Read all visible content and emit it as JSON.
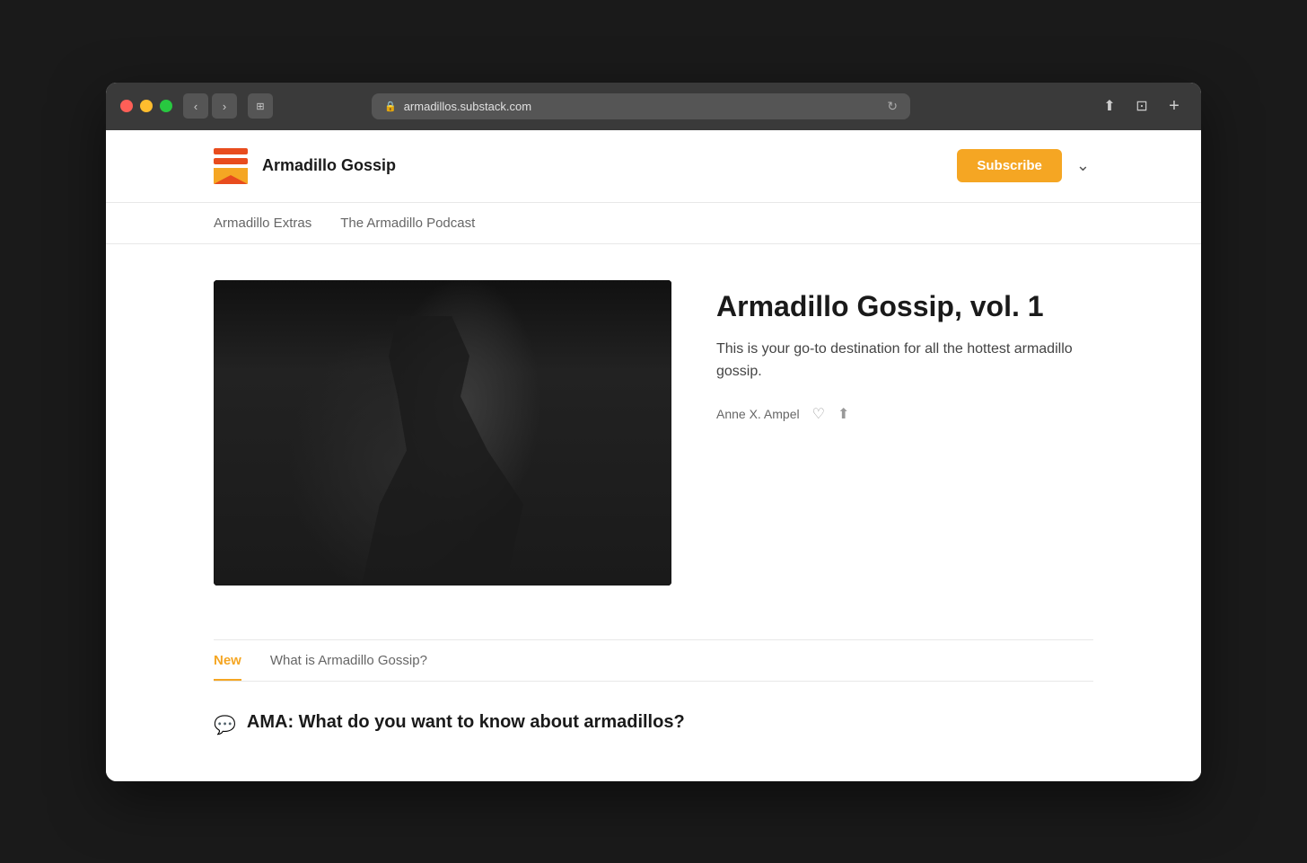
{
  "browser": {
    "url": "armadillos.substack.com",
    "back_label": "‹",
    "forward_label": "›",
    "sidebar_label": "⊞",
    "refresh_label": "↻",
    "share_label": "⬆",
    "tab_label": "⊡",
    "add_tab_label": "+"
  },
  "header": {
    "brand_name": "Armadillo Gossip",
    "subscribe_label": "Subscribe",
    "chevron_label": "⌄"
  },
  "nav": {
    "items": [
      {
        "label": "Armadillo Extras",
        "active": false
      },
      {
        "label": "The Armadillo Podcast",
        "active": false
      }
    ]
  },
  "featured": {
    "title": "Armadillo Gossip, vol. 1",
    "description": "This is your go-to destination for all the hottest armadillo gossip.",
    "author": "Anne X. Ampel"
  },
  "tabs": {
    "items": [
      {
        "label": "New",
        "active": true
      },
      {
        "label": "What is Armadillo Gossip?",
        "active": false
      }
    ]
  },
  "posts": [
    {
      "icon": "💬",
      "title": "AMA: What do you want to know about armadillos?"
    }
  ]
}
